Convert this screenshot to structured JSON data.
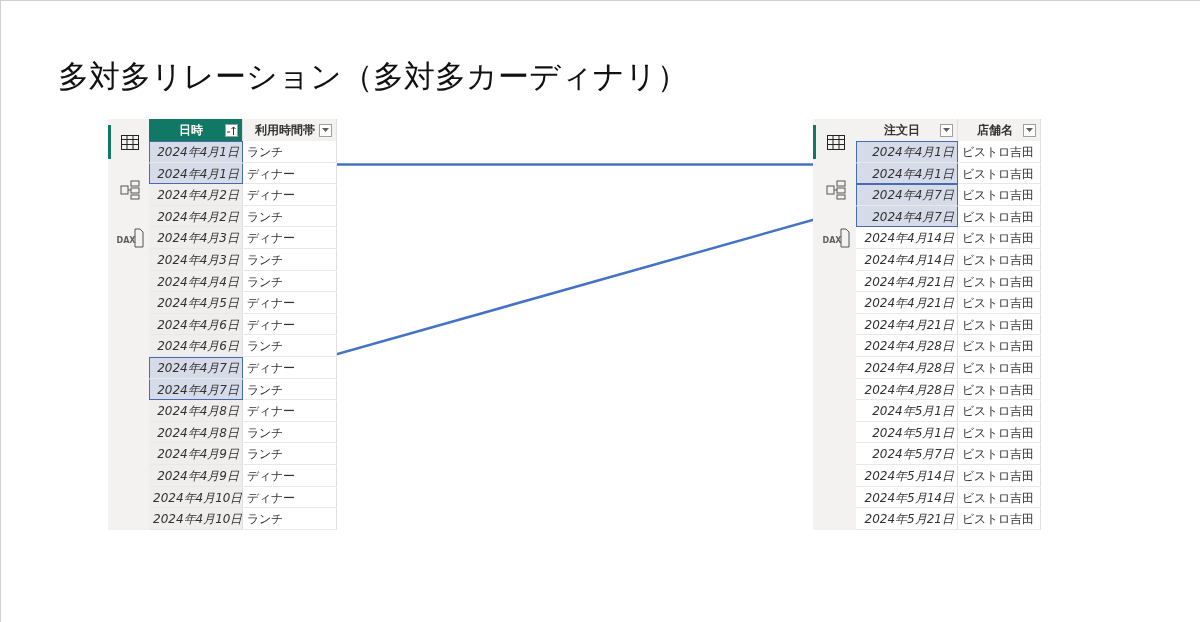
{
  "slide": {
    "title": "多対多リレーション（多対多カーディナリ）"
  },
  "tables": [
    {
      "views": [
        {
          "kind": "table",
          "selected": true
        },
        {
          "kind": "model",
          "selected": false
        },
        {
          "kind": "dax",
          "selected": false,
          "label": "DAX"
        }
      ],
      "columns": [
        {
          "label": "日時",
          "selected": true,
          "sorted": true
        },
        {
          "label": "利用時間帯",
          "selected": false,
          "sorted": false
        }
      ],
      "rows": [
        {
          "cells": [
            "2024年4月1日",
            "ランチ"
          ],
          "selected": true,
          "box_top": true
        },
        {
          "cells": [
            "2024年4月1日",
            "ディナー"
          ],
          "selected": true,
          "box_top": false
        },
        {
          "cells": [
            "2024年4月2日",
            "ディナー"
          ],
          "selected": false,
          "box_top": false
        },
        {
          "cells": [
            "2024年4月2日",
            "ランチ"
          ],
          "selected": false,
          "box_top": false
        },
        {
          "cells": [
            "2024年4月3日",
            "ディナー"
          ],
          "selected": false,
          "box_top": false
        },
        {
          "cells": [
            "2024年4月3日",
            "ランチ"
          ],
          "selected": false,
          "box_top": false
        },
        {
          "cells": [
            "2024年4月4日",
            "ランチ"
          ],
          "selected": false,
          "box_top": false
        },
        {
          "cells": [
            "2024年4月5日",
            "ディナー"
          ],
          "selected": false,
          "box_top": false
        },
        {
          "cells": [
            "2024年4月6日",
            "ディナー"
          ],
          "selected": false,
          "box_top": false
        },
        {
          "cells": [
            "2024年4月6日",
            "ランチ"
          ],
          "selected": false,
          "box_top": false
        },
        {
          "cells": [
            "2024年4月7日",
            "ディナー"
          ],
          "selected": true,
          "box_top": true
        },
        {
          "cells": [
            "2024年4月7日",
            "ランチ"
          ],
          "selected": true,
          "box_top": false
        },
        {
          "cells": [
            "2024年4月8日",
            "ディナー"
          ],
          "selected": false,
          "box_top": false
        },
        {
          "cells": [
            "2024年4月8日",
            "ランチ"
          ],
          "selected": false,
          "box_top": false
        },
        {
          "cells": [
            "2024年4月9日",
            "ランチ"
          ],
          "selected": false,
          "box_top": false
        },
        {
          "cells": [
            "2024年4月9日",
            "ディナー"
          ],
          "selected": false,
          "box_top": false
        },
        {
          "cells": [
            "2024年4月10日",
            "ディナー"
          ],
          "selected": false,
          "box_top": false
        },
        {
          "cells": [
            "2024年4月10日",
            "ランチ"
          ],
          "selected": false,
          "box_top": false
        }
      ]
    },
    {
      "views": [
        {
          "kind": "table",
          "selected": true
        },
        {
          "kind": "model",
          "selected": false
        },
        {
          "kind": "dax",
          "selected": false,
          "label": "DAX"
        }
      ],
      "columns": [
        {
          "label": "注文日",
          "selected": false,
          "sorted": false
        },
        {
          "label": "店舗名",
          "selected": false,
          "sorted": false
        }
      ],
      "rows": [
        {
          "cells": [
            "2024年4月1日",
            "ビストロ吉田"
          ],
          "selected": true,
          "box_top": true
        },
        {
          "cells": [
            "2024年4月1日",
            "ビストロ吉田"
          ],
          "selected": true,
          "box_top": false
        },
        {
          "cells": [
            "2024年4月7日",
            "ビストロ吉田"
          ],
          "selected": true,
          "box_top": true
        },
        {
          "cells": [
            "2024年4月7日",
            "ビストロ吉田"
          ],
          "selected": true,
          "box_top": false
        },
        {
          "cells": [
            "2024年4月14日",
            "ビストロ吉田"
          ],
          "selected": false,
          "box_top": false
        },
        {
          "cells": [
            "2024年4月14日",
            "ビストロ吉田"
          ],
          "selected": false,
          "box_top": false
        },
        {
          "cells": [
            "2024年4月21日",
            "ビストロ吉田"
          ],
          "selected": false,
          "box_top": false
        },
        {
          "cells": [
            "2024年4月21日",
            "ビストロ吉田"
          ],
          "selected": false,
          "box_top": false
        },
        {
          "cells": [
            "2024年4月21日",
            "ビストロ吉田"
          ],
          "selected": false,
          "box_top": false
        },
        {
          "cells": [
            "2024年4月28日",
            "ビストロ吉田"
          ],
          "selected": false,
          "box_top": false
        },
        {
          "cells": [
            "2024年4月28日",
            "ビストロ吉田"
          ],
          "selected": false,
          "box_top": false
        },
        {
          "cells": [
            "2024年4月28日",
            "ビストロ吉田"
          ],
          "selected": false,
          "box_top": false
        },
        {
          "cells": [
            "2024年5月1日",
            "ビストロ吉田"
          ],
          "selected": false,
          "box_top": false
        },
        {
          "cells": [
            "2024年5月1日",
            "ビストロ吉田"
          ],
          "selected": false,
          "box_top": false
        },
        {
          "cells": [
            "2024年5月7日",
            "ビストロ吉田"
          ],
          "selected": false,
          "box_top": false
        },
        {
          "cells": [
            "2024年5月14日",
            "ビストロ吉田"
          ],
          "selected": false,
          "box_top": false
        },
        {
          "cells": [
            "2024年5月14日",
            "ビストロ吉田"
          ],
          "selected": false,
          "box_top": false
        },
        {
          "cells": [
            "2024年5月21日",
            "ビストロ吉田"
          ],
          "selected": false,
          "box_top": false
        }
      ]
    }
  ]
}
